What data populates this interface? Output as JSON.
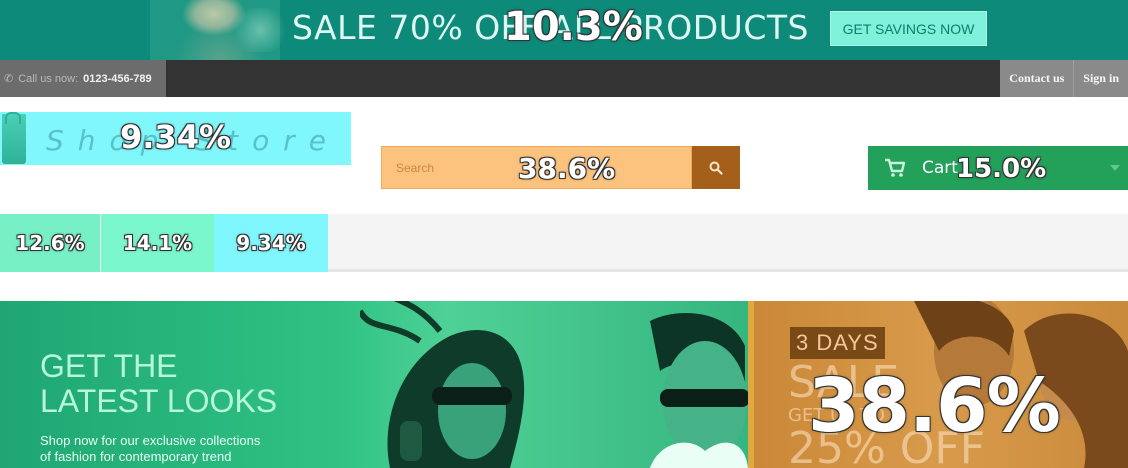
{
  "promo": {
    "headline": "SALE 70% OFF ALL PRODUCTS",
    "cta": "GET SAVINGS NOW",
    "percent": "10.3%"
  },
  "topbar": {
    "call_label": "Call us now:",
    "phone": "0123-456-789",
    "links": [
      "Contact us",
      "Sign in"
    ]
  },
  "logo": {
    "text": "Shop Store",
    "percent": "9.34%"
  },
  "search": {
    "placeholder": "Search",
    "percent": "38.6%",
    "icon": "search-icon"
  },
  "cart": {
    "label": "Cart",
    "percent": "15.0%",
    "icon": "cart-icon"
  },
  "categories": [
    {
      "percent": "12.6%"
    },
    {
      "percent": "14.1%"
    },
    {
      "percent": "9.34%"
    }
  ],
  "hero": {
    "headline_line1": "GET THE",
    "headline_line2": "LATEST LOOKS",
    "subtext_line1": "Shop now for our exclusive collections",
    "subtext_line2": "of fashion for contemporary trend",
    "side_badge": "3 DAYS",
    "side_ghost_1": "SALE",
    "side_ghost_2": "GET UP TO",
    "side_ghost_3": "25% OFF",
    "side_percent": "38.6%"
  },
  "colors": {
    "promo_bg": "#0d8a7a",
    "topbar_bg": "#333333",
    "logo_bg": "#7ff7fb",
    "search_bg": "#fcc37e",
    "search_btn": "#a4601b",
    "cart_bg": "#23a05a",
    "hero_main": "#2fc283",
    "hero_side": "#d89b4b"
  }
}
